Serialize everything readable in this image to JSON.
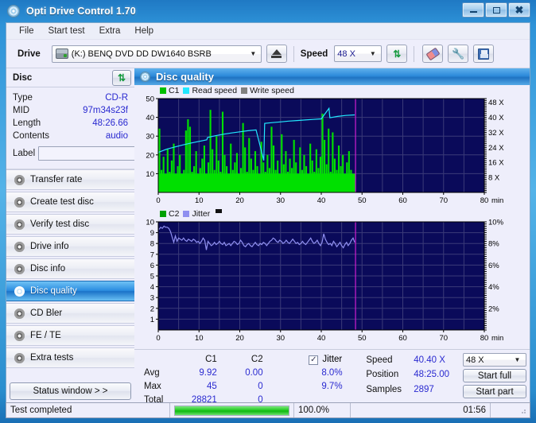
{
  "window": {
    "title": "Opti Drive Control 1.70",
    "icon": "disc-icon",
    "minimize": "minimize-icon",
    "maximize": "maximize-icon",
    "close": "close-icon"
  },
  "menu": {
    "items": [
      "File",
      "Start test",
      "Extra",
      "Help"
    ]
  },
  "toolbar": {
    "drive_label": "Drive",
    "drive_value": "(K:)  BENQ DVD DD DW1640 BSRB",
    "eject_icon": "eject-icon",
    "speed_label": "Speed",
    "speed_value": "48 X",
    "refresh_icon": "refresh-arrows-icon",
    "eraser_icon": "eraser-icon",
    "wrench_icon": "wrench-icon",
    "save_icon": "save-floppy-icon"
  },
  "disc_panel": {
    "title": "Disc",
    "refresh_icon": "refresh-arrows-icon",
    "rows": [
      {
        "key": "Type",
        "value": "CD-R"
      },
      {
        "key": "MID",
        "value": "97m34s23f"
      },
      {
        "key": "Length",
        "value": "48:26.66"
      },
      {
        "key": "Contents",
        "value": "audio"
      }
    ],
    "label_key": "Label",
    "label_value": "",
    "label_placeholder": ""
  },
  "nav": {
    "items": [
      {
        "label": "Transfer rate",
        "active": false
      },
      {
        "label": "Create test disc",
        "active": false
      },
      {
        "label": "Verify test disc",
        "active": false
      },
      {
        "label": "Drive info",
        "active": false
      },
      {
        "label": "Disc info",
        "active": false
      },
      {
        "label": "Disc quality",
        "active": true
      },
      {
        "label": "CD Bler",
        "active": false
      },
      {
        "label": "FE / TE",
        "active": false
      },
      {
        "label": "Extra tests",
        "active": false
      }
    ],
    "status_window_button": "Status window > >"
  },
  "section": {
    "title": "Disc quality",
    "icon": "disc-icon"
  },
  "stats": {
    "col_c1": "C1",
    "col_c2": "C2",
    "jitter_label": "Jitter",
    "jitter_checked": true,
    "rows": [
      {
        "label": "Avg",
        "c1": "9.92",
        "c2": "0.00",
        "jitter": "8.0%"
      },
      {
        "label": "Max",
        "c1": "45",
        "c2": "0",
        "jitter": "9.7%"
      },
      {
        "label": "Total",
        "c1": "28821",
        "c2": "0",
        "jitter": ""
      }
    ],
    "speed_label": "Speed",
    "speed_value": "40.40 X",
    "position_label": "Position",
    "position_value": "48:25.00",
    "samples_label": "Samples",
    "samples_value": "2897",
    "speed_select": "48 X",
    "start_full": "Start full",
    "start_part": "Start part"
  },
  "statusbar": {
    "message": "Test completed",
    "percent": "100.0%",
    "progress_fraction": 1.0,
    "elapsed": "01:56"
  },
  "colors": {
    "c1_green": "#00e000",
    "read_speed_cyan": "#22e8ff",
    "write_speed_gray": "#808080",
    "jitter_violet": "#8f8ff0",
    "c2_green": "#00a000",
    "plot_bg": "#0a0a5a",
    "marker_magenta": "#d01ed0",
    "accent_blue": "#2d8ada"
  },
  "chart_data": [
    {
      "type": "line",
      "title": "C1 / Read speed / Write speed",
      "legend": [
        {
          "name": "C1",
          "color": "#00c000"
        },
        {
          "name": "Read speed",
          "color": "#22e8ff"
        },
        {
          "name": "Write speed",
          "color": "#808080"
        }
      ],
      "legend_position": "top-left",
      "xlabel": "min",
      "ylabel": "",
      "xlim": [
        0,
        80
      ],
      "xticks": [
        0,
        10,
        20,
        30,
        40,
        50,
        60,
        70,
        80
      ],
      "ylim": [
        0,
        50
      ],
      "yticks": [
        10,
        20,
        30,
        40,
        50
      ],
      "y2label": "X",
      "y2lim": [
        0,
        50
      ],
      "y2ticks": [
        8,
        16,
        24,
        32,
        40,
        48
      ],
      "y2ticklabels": [
        "8 X",
        "16 X",
        "24 X",
        "32 X",
        "40 X",
        "48 X"
      ],
      "grid": true,
      "data_end_min": 48.4,
      "marker_min": 48.4,
      "series": [
        {
          "name": "C1",
          "kind": "bars",
          "color": "#00e000",
          "x": [
            0.3,
            0.8,
            1.3,
            1.8,
            2.3,
            2.8,
            3.3,
            3.8,
            4.3,
            4.8,
            5.3,
            5.8,
            6.3,
            6.8,
            7.3,
            7.8,
            8.3,
            8.8,
            9.3,
            9.8,
            10.3,
            10.8,
            11.3,
            11.8,
            12.3,
            12.8,
            13.3,
            13.8,
            14.3,
            14.8,
            15.3,
            15.8,
            16.3,
            16.8,
            17.3,
            17.8,
            18.3,
            18.8,
            19.3,
            19.8,
            20.3,
            20.8,
            21.3,
            21.8,
            22.3,
            22.8,
            23.3,
            23.8,
            24.3,
            24.8,
            25.3,
            25.8,
            26.3,
            26.8,
            27.3,
            27.8,
            28.3,
            28.8,
            29.3,
            29.8,
            30.3,
            30.8,
            31.3,
            31.8,
            32.3,
            32.8,
            33.3,
            33.8,
            34.3,
            34.8,
            35.3,
            35.8,
            36.3,
            36.8,
            37.3,
            37.8,
            38.3,
            38.8,
            39.3,
            39.8,
            40.3,
            40.8,
            41.3,
            41.8,
            42.3,
            42.8,
            43.3,
            43.8,
            44.3,
            44.8,
            45.3,
            45.8,
            46.3,
            46.8,
            47.3,
            47.8
          ],
          "values": [
            34,
            12,
            19,
            9,
            23,
            11,
            17,
            26,
            10,
            14,
            20,
            8,
            12,
            33,
            39,
            35,
            11,
            14,
            22,
            9,
            13,
            18,
            25,
            10,
            16,
            44,
            23,
            12,
            30,
            17,
            11,
            43,
            20,
            14,
            9,
            26,
            12,
            16,
            21,
            10,
            13,
            37,
            24,
            11,
            29,
            18,
            12,
            22,
            14,
            9,
            27,
            16,
            11,
            20,
            13,
            35,
            25,
            12,
            17,
            10,
            31,
            15,
            22,
            11,
            18,
            13,
            28,
            16,
            10,
            24,
            12,
            20,
            14,
            9,
            26,
            17,
            11,
            23,
            13,
            19,
            42,
            28,
            15,
            34,
            11,
            32,
            18,
            12,
            25,
            14,
            20,
            10,
            16,
            22,
            12,
            8
          ]
        },
        {
          "name": "Read speed",
          "kind": "line",
          "color": "#22e8ff",
          "x": [
            0,
            2,
            4,
            6,
            8,
            10,
            11.9,
            12.1,
            14,
            16,
            18,
            20,
            22,
            24,
            25.9,
            26.1,
            28,
            30,
            32,
            34,
            36,
            38,
            40,
            41.9,
            42.1,
            44,
            46,
            48.2
          ],
          "values": [
            21.3,
            23.0,
            24.2,
            25.3,
            26.3,
            27.2,
            28.0,
            29.3,
            30.2,
            31.0,
            31.7,
            32.3,
            32.9,
            33.3,
            17.0,
            36.8,
            37.2,
            37.6,
            38.0,
            38.3,
            38.6,
            38.9,
            39.2,
            44.8,
            39.8,
            40.5,
            41.0,
            41.3
          ]
        },
        {
          "name": "Write speed",
          "kind": "line",
          "color": "#808080",
          "x": [],
          "values": []
        }
      ]
    },
    {
      "type": "line",
      "title": "C2 / Jitter",
      "legend": [
        {
          "name": "C2",
          "color": "#00a000"
        },
        {
          "name": "Jitter",
          "color": "#8f8ff0"
        }
      ],
      "legend_position": "top-left",
      "xlabel": "min",
      "ylabel": "",
      "xlim": [
        0,
        80
      ],
      "xticks": [
        0,
        10,
        20,
        30,
        40,
        50,
        60,
        70,
        80
      ],
      "ylim": [
        0,
        10
      ],
      "yticks": [
        1,
        2,
        3,
        4,
        5,
        6,
        7,
        8,
        9,
        10
      ],
      "y2label": "%",
      "y2lim": [
        0,
        10
      ],
      "y2ticks": [
        2,
        4,
        6,
        8,
        10
      ],
      "y2ticklabels": [
        "2%",
        "4%",
        "6%",
        "8%",
        "10%"
      ],
      "grid": true,
      "data_end_min": 48.4,
      "marker_min": 48.4,
      "series": [
        {
          "name": "C2",
          "kind": "bars",
          "color": "#00a000",
          "x": [],
          "values": []
        },
        {
          "name": "Jitter",
          "kind": "line",
          "color": "#8f8ff0",
          "x": [
            0.2,
            0.6,
            1.0,
            1.4,
            1.8,
            2.2,
            2.6,
            3.0,
            3.4,
            3.8,
            4.2,
            4.6,
            5.0,
            5.4,
            5.8,
            6.2,
            6.6,
            7.0,
            7.4,
            7.8,
            8.2,
            8.6,
            9.0,
            9.4,
            9.8,
            10.2,
            10.6,
            11.0,
            11.4,
            11.8,
            12.2,
            12.6,
            13.0,
            13.4,
            13.8,
            14.2,
            14.6,
            15.0,
            15.4,
            15.8,
            16.2,
            16.6,
            17.0,
            17.4,
            17.8,
            18.2,
            18.6,
            19.0,
            19.4,
            19.8,
            20.2,
            20.6,
            21.0,
            21.4,
            21.8,
            22.2,
            22.6,
            23.0,
            23.4,
            23.8,
            24.2,
            24.6,
            25.0,
            25.4,
            25.8,
            26.2,
            26.6,
            27.0,
            27.4,
            27.8,
            28.2,
            28.6,
            29.0,
            29.4,
            29.8,
            30.2,
            30.6,
            31.0,
            31.4,
            31.8,
            32.2,
            32.6,
            33.0,
            33.4,
            33.8,
            34.2,
            34.6,
            35.0,
            35.4,
            35.8,
            36.2,
            36.6,
            37.0,
            37.4,
            37.8,
            38.2,
            38.6,
            39.0,
            39.4,
            39.8,
            40.2,
            40.6,
            41.0,
            41.4,
            41.8,
            42.2,
            42.6,
            43.0,
            43.4,
            43.8,
            44.2,
            44.6,
            45.0,
            45.4,
            45.8,
            46.2,
            46.6,
            47.0,
            47.4,
            47.8,
            48.2
          ],
          "values": [
            9.3,
            9.5,
            9.4,
            9.6,
            9.5,
            9.5,
            9.4,
            9.1,
            8.6,
            8.1,
            8.7,
            8.2,
            8.5,
            8.4,
            8.3,
            8.5,
            8.3,
            8.2,
            8.4,
            8.3,
            8.2,
            8.4,
            8.3,
            8.1,
            8.2,
            8.0,
            8.2,
            8.5,
            8.3,
            7.4,
            8.2,
            8.0,
            7.8,
            7.9,
            8.1,
            7.9,
            8.0,
            8.2,
            8.0,
            7.9,
            8.1,
            7.8,
            7.9,
            8.0,
            7.8,
            8.0,
            8.2,
            8.1,
            7.9,
            8.0,
            8.3,
            8.1,
            7.8,
            7.7,
            7.9,
            8.0,
            7.8,
            7.7,
            7.9,
            8.1,
            7.9,
            7.8,
            8.0,
            7.9,
            8.1,
            8.0,
            7.8,
            8.0,
            8.2,
            8.3,
            8.5,
            8.4,
            8.2,
            8.1,
            8.3,
            8.2,
            8.0,
            8.1,
            8.3,
            8.1,
            8.0,
            8.2,
            8.4,
            8.2,
            8.0,
            8.1,
            7.9,
            8.0,
            8.2,
            8.0,
            7.9,
            8.1,
            8.3,
            8.5,
            8.2,
            8.0,
            8.1,
            8.3,
            8.0,
            7.8,
            8.1,
            8.9,
            8.4,
            8.1,
            7.9,
            8.0,
            7.8,
            8.2,
            8.0,
            7.7,
            7.9,
            8.1,
            7.8,
            7.6,
            7.9,
            8.1,
            7.8,
            8.0,
            8.3,
            8.5,
            8.1
          ]
        }
      ]
    }
  ]
}
